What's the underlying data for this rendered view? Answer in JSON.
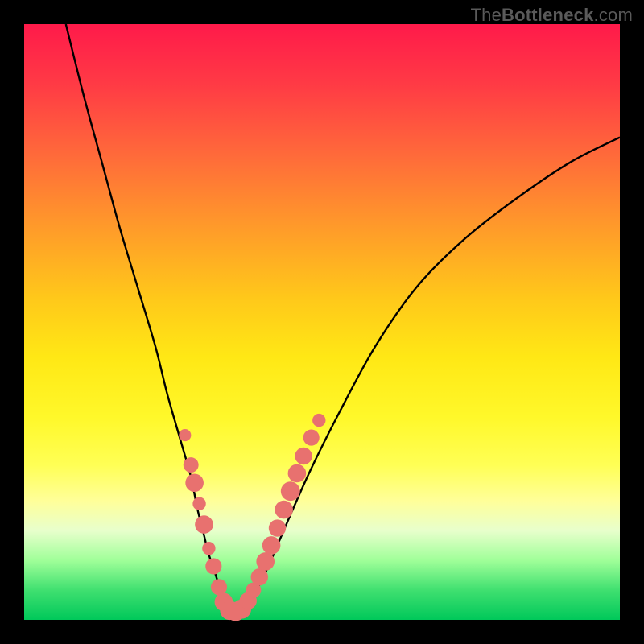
{
  "watermark": {
    "prefix": "The",
    "bold": "Bottleneck",
    "suffix": ".com"
  },
  "chart_data": {
    "type": "line",
    "title": "",
    "xlabel": "",
    "ylabel": "",
    "xlim": [
      0,
      100
    ],
    "ylim": [
      0,
      100
    ],
    "series": [
      {
        "name": "curve-left",
        "x": [
          7,
          10,
          13,
          16,
          19,
          22,
          24,
          26,
          28,
          29,
          30,
          31,
          32,
          33,
          34,
          35
        ],
        "y": [
          100,
          88,
          77,
          66,
          56,
          46,
          38,
          31,
          24,
          19,
          15,
          11,
          8,
          5,
          3,
          1
        ]
      },
      {
        "name": "curve-right",
        "x": [
          35,
          37,
          39,
          41,
          44,
          48,
          53,
          59,
          66,
          74,
          83,
          92,
          100
        ],
        "y": [
          1,
          2,
          5,
          9,
          16,
          25,
          35,
          46,
          56,
          64,
          71,
          77,
          81
        ]
      }
    ],
    "markers_left": {
      "name": "dots-left-branch",
      "color": "#e8716f",
      "points": [
        {
          "x": 27.0,
          "y": 31.0,
          "r": 1.2
        },
        {
          "x": 28.0,
          "y": 26.0,
          "r": 1.5
        },
        {
          "x": 28.6,
          "y": 23.0,
          "r": 1.8
        },
        {
          "x": 29.4,
          "y": 19.5,
          "r": 1.3
        },
        {
          "x": 30.2,
          "y": 16.0,
          "r": 1.8
        },
        {
          "x": 31.0,
          "y": 12.0,
          "r": 1.3
        },
        {
          "x": 31.8,
          "y": 9.0,
          "r": 1.6
        },
        {
          "x": 32.7,
          "y": 5.5,
          "r": 1.6
        },
        {
          "x": 33.5,
          "y": 3.0,
          "r": 1.8
        },
        {
          "x": 34.5,
          "y": 1.6,
          "r": 1.9
        }
      ]
    },
    "markers_right": {
      "name": "dots-right-branch",
      "color": "#e8716f",
      "points": [
        {
          "x": 35.5,
          "y": 1.4,
          "r": 1.9
        },
        {
          "x": 36.5,
          "y": 1.8,
          "r": 1.9
        },
        {
          "x": 37.6,
          "y": 3.2,
          "r": 1.7
        },
        {
          "x": 38.5,
          "y": 5.0,
          "r": 1.5
        },
        {
          "x": 39.5,
          "y": 7.2,
          "r": 1.7
        },
        {
          "x": 40.5,
          "y": 9.8,
          "r": 1.8
        },
        {
          "x": 41.5,
          "y": 12.5,
          "r": 1.8
        },
        {
          "x": 42.5,
          "y": 15.4,
          "r": 1.7
        },
        {
          "x": 43.6,
          "y": 18.5,
          "r": 1.8
        },
        {
          "x": 44.7,
          "y": 21.6,
          "r": 1.9
        },
        {
          "x": 45.8,
          "y": 24.6,
          "r": 1.8
        },
        {
          "x": 46.9,
          "y": 27.5,
          "r": 1.7
        },
        {
          "x": 48.2,
          "y": 30.6,
          "r": 1.6
        },
        {
          "x": 49.5,
          "y": 33.5,
          "r": 1.3
        }
      ]
    }
  }
}
